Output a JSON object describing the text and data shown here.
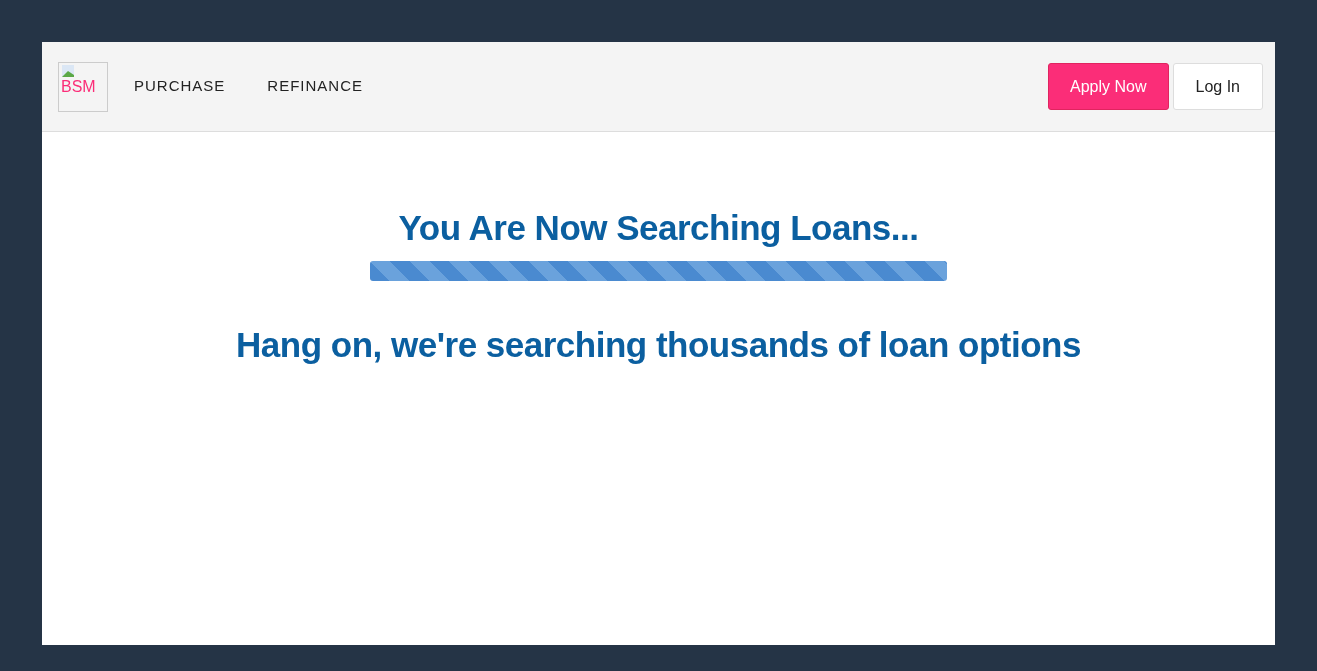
{
  "navbar": {
    "logo_alt": "BSM",
    "links": [
      "PURCHASE",
      "REFINANCE"
    ],
    "buttons": [
      {
        "label": "Apply Now",
        "kind": "primary"
      },
      {
        "label": "Log In",
        "kind": "secondary"
      }
    ]
  },
  "search": {
    "title": "You Are Now Searching Loans...",
    "subtitle": "Hang on, we're searching thousands of loan options"
  }
}
